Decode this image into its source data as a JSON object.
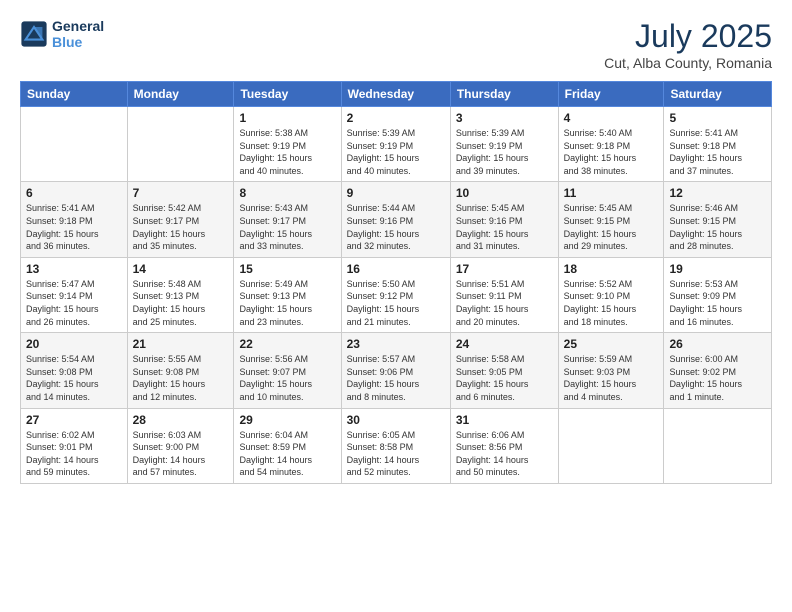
{
  "header": {
    "logo_line1": "General",
    "logo_line2": "Blue",
    "title": "July 2025",
    "subtitle": "Cut, Alba County, Romania"
  },
  "weekdays": [
    "Sunday",
    "Monday",
    "Tuesday",
    "Wednesday",
    "Thursday",
    "Friday",
    "Saturday"
  ],
  "weeks": [
    [
      {
        "day": "",
        "info": ""
      },
      {
        "day": "",
        "info": ""
      },
      {
        "day": "1",
        "info": "Sunrise: 5:38 AM\nSunset: 9:19 PM\nDaylight: 15 hours\nand 40 minutes."
      },
      {
        "day": "2",
        "info": "Sunrise: 5:39 AM\nSunset: 9:19 PM\nDaylight: 15 hours\nand 40 minutes."
      },
      {
        "day": "3",
        "info": "Sunrise: 5:39 AM\nSunset: 9:19 PM\nDaylight: 15 hours\nand 39 minutes."
      },
      {
        "day": "4",
        "info": "Sunrise: 5:40 AM\nSunset: 9:18 PM\nDaylight: 15 hours\nand 38 minutes."
      },
      {
        "day": "5",
        "info": "Sunrise: 5:41 AM\nSunset: 9:18 PM\nDaylight: 15 hours\nand 37 minutes."
      }
    ],
    [
      {
        "day": "6",
        "info": "Sunrise: 5:41 AM\nSunset: 9:18 PM\nDaylight: 15 hours\nand 36 minutes."
      },
      {
        "day": "7",
        "info": "Sunrise: 5:42 AM\nSunset: 9:17 PM\nDaylight: 15 hours\nand 35 minutes."
      },
      {
        "day": "8",
        "info": "Sunrise: 5:43 AM\nSunset: 9:17 PM\nDaylight: 15 hours\nand 33 minutes."
      },
      {
        "day": "9",
        "info": "Sunrise: 5:44 AM\nSunset: 9:16 PM\nDaylight: 15 hours\nand 32 minutes."
      },
      {
        "day": "10",
        "info": "Sunrise: 5:45 AM\nSunset: 9:16 PM\nDaylight: 15 hours\nand 31 minutes."
      },
      {
        "day": "11",
        "info": "Sunrise: 5:45 AM\nSunset: 9:15 PM\nDaylight: 15 hours\nand 29 minutes."
      },
      {
        "day": "12",
        "info": "Sunrise: 5:46 AM\nSunset: 9:15 PM\nDaylight: 15 hours\nand 28 minutes."
      }
    ],
    [
      {
        "day": "13",
        "info": "Sunrise: 5:47 AM\nSunset: 9:14 PM\nDaylight: 15 hours\nand 26 minutes."
      },
      {
        "day": "14",
        "info": "Sunrise: 5:48 AM\nSunset: 9:13 PM\nDaylight: 15 hours\nand 25 minutes."
      },
      {
        "day": "15",
        "info": "Sunrise: 5:49 AM\nSunset: 9:13 PM\nDaylight: 15 hours\nand 23 minutes."
      },
      {
        "day": "16",
        "info": "Sunrise: 5:50 AM\nSunset: 9:12 PM\nDaylight: 15 hours\nand 21 minutes."
      },
      {
        "day": "17",
        "info": "Sunrise: 5:51 AM\nSunset: 9:11 PM\nDaylight: 15 hours\nand 20 minutes."
      },
      {
        "day": "18",
        "info": "Sunrise: 5:52 AM\nSunset: 9:10 PM\nDaylight: 15 hours\nand 18 minutes."
      },
      {
        "day": "19",
        "info": "Sunrise: 5:53 AM\nSunset: 9:09 PM\nDaylight: 15 hours\nand 16 minutes."
      }
    ],
    [
      {
        "day": "20",
        "info": "Sunrise: 5:54 AM\nSunset: 9:08 PM\nDaylight: 15 hours\nand 14 minutes."
      },
      {
        "day": "21",
        "info": "Sunrise: 5:55 AM\nSunset: 9:08 PM\nDaylight: 15 hours\nand 12 minutes."
      },
      {
        "day": "22",
        "info": "Sunrise: 5:56 AM\nSunset: 9:07 PM\nDaylight: 15 hours\nand 10 minutes."
      },
      {
        "day": "23",
        "info": "Sunrise: 5:57 AM\nSunset: 9:06 PM\nDaylight: 15 hours\nand 8 minutes."
      },
      {
        "day": "24",
        "info": "Sunrise: 5:58 AM\nSunset: 9:05 PM\nDaylight: 15 hours\nand 6 minutes."
      },
      {
        "day": "25",
        "info": "Sunrise: 5:59 AM\nSunset: 9:03 PM\nDaylight: 15 hours\nand 4 minutes."
      },
      {
        "day": "26",
        "info": "Sunrise: 6:00 AM\nSunset: 9:02 PM\nDaylight: 15 hours\nand 1 minute."
      }
    ],
    [
      {
        "day": "27",
        "info": "Sunrise: 6:02 AM\nSunset: 9:01 PM\nDaylight: 14 hours\nand 59 minutes."
      },
      {
        "day": "28",
        "info": "Sunrise: 6:03 AM\nSunset: 9:00 PM\nDaylight: 14 hours\nand 57 minutes."
      },
      {
        "day": "29",
        "info": "Sunrise: 6:04 AM\nSunset: 8:59 PM\nDaylight: 14 hours\nand 54 minutes."
      },
      {
        "day": "30",
        "info": "Sunrise: 6:05 AM\nSunset: 8:58 PM\nDaylight: 14 hours\nand 52 minutes."
      },
      {
        "day": "31",
        "info": "Sunrise: 6:06 AM\nSunset: 8:56 PM\nDaylight: 14 hours\nand 50 minutes."
      },
      {
        "day": "",
        "info": ""
      },
      {
        "day": "",
        "info": ""
      }
    ]
  ]
}
